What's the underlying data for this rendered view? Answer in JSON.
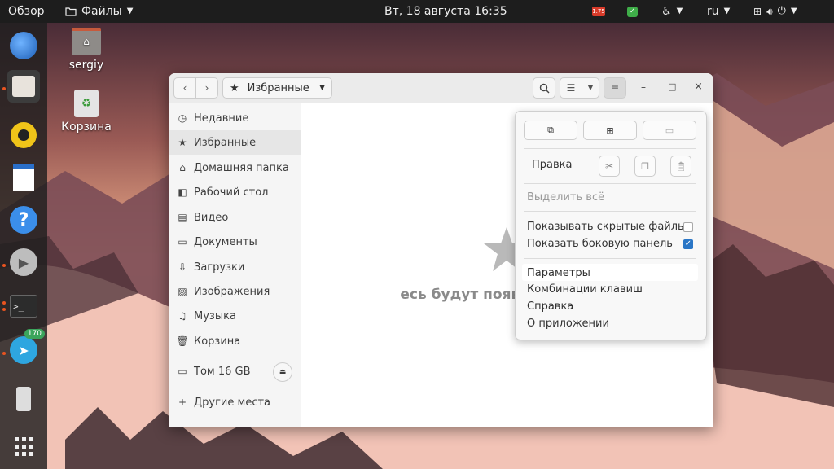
{
  "topbar": {
    "activities": "Обзор",
    "app_menu": "Файлы",
    "clock": "Вт, 18 августа  16:35",
    "lang": "ru",
    "badge_tray": "1.75"
  },
  "desktop": {
    "home_label": "sergiy",
    "trash_label": "Корзина"
  },
  "dock": {
    "telegram_badge": "170"
  },
  "window": {
    "location": "Избранные",
    "sidebar": {
      "recent": "Недавние",
      "starred": "Избранные",
      "home": "Домашняя папка",
      "desktop": "Рабочий стол",
      "video": "Видео",
      "documents": "Документы",
      "downloads": "Загрузки",
      "pictures": "Изображения",
      "music": "Музыка",
      "trash": "Корзина",
      "volume": "Том 16 GB",
      "other": "Другие места"
    },
    "empty_message": "есь будут появляться добав"
  },
  "menu": {
    "edit_label": "Правка",
    "select_all": "Выделить всё",
    "show_hidden": "Показывать скрытые файлы",
    "show_sidebar": "Показать боковую панель",
    "preferences": "Параметры",
    "shortcuts": "Комбинации клавиш",
    "help": "Справка",
    "about": "О приложении"
  },
  "colors": {
    "accent": "#e95420",
    "check": "#2a76c6"
  }
}
